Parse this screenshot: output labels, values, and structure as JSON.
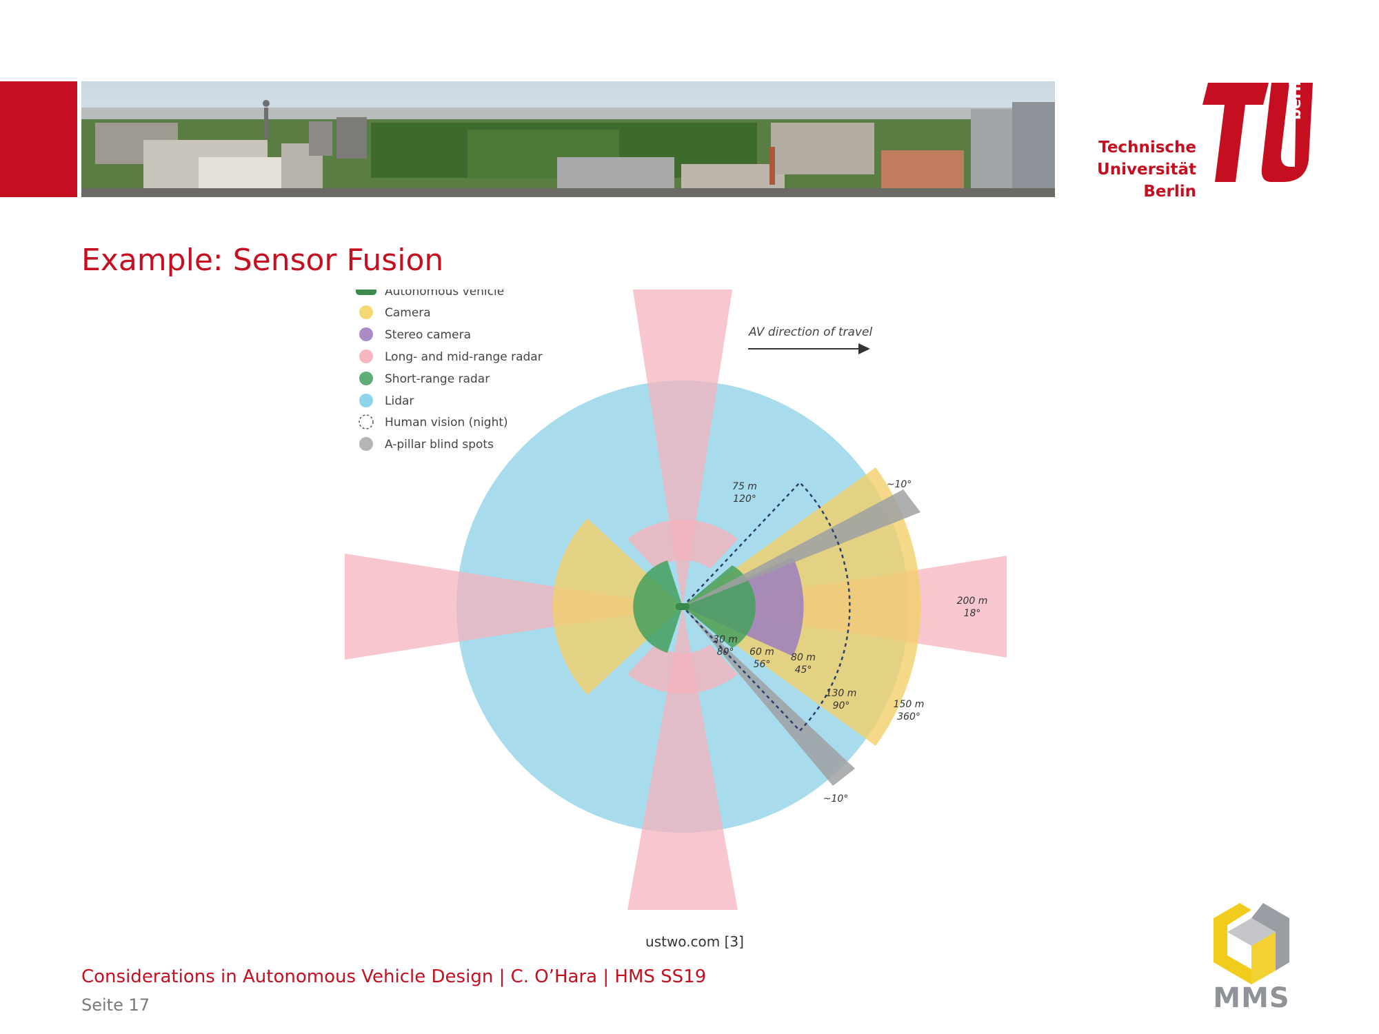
{
  "header": {
    "university_name_lines": [
      "Technische",
      "Universität",
      "Berlin"
    ],
    "logo_word": "berlin",
    "brand_color": "#c50e1f",
    "banner_image": "berlin-city-skyline-photo"
  },
  "slide": {
    "title": "Example: Sensor Fusion",
    "source": "ustwo.com [3]",
    "footer_title": "Considerations in Autonomous Vehicle Design | C. O’Hara | HMS SS19",
    "page_label": "Seite 17"
  },
  "diagram": {
    "legend": [
      {
        "label": "Autonomous vehicle",
        "color": "#3a8a4a",
        "icon": "car-icon"
      },
      {
        "label": "Camera",
        "color": "#f3d873",
        "icon": "dot"
      },
      {
        "label": "Stereo camera",
        "color": "#a98cc5",
        "icon": "dot"
      },
      {
        "label": "Long- and mid-range radar",
        "color": "#f5b8c0",
        "icon": "dot"
      },
      {
        "label": "Short-range radar",
        "color": "#5fae78",
        "icon": "dot"
      },
      {
        "label": "Lidar",
        "color": "#8dd4ea",
        "icon": "dot"
      },
      {
        "label": "Human vision (night)",
        "color": "#555555",
        "icon": "dashed-circle"
      },
      {
        "label": "A-pillar blind spots",
        "color": "#b5b5b5",
        "icon": "dot"
      }
    ],
    "direction_label": "AV direction of travel",
    "annotations": [
      {
        "lines": [
          "75 m",
          "120°"
        ]
      },
      {
        "lines": [
          "~10°"
        ]
      },
      {
        "lines": [
          "200 m",
          "18°"
        ]
      },
      {
        "lines": [
          "30 m",
          "80°"
        ]
      },
      {
        "lines": [
          "60 m",
          "56°"
        ]
      },
      {
        "lines": [
          "80 m",
          "45°"
        ]
      },
      {
        "lines": [
          "130 m",
          "90°"
        ]
      },
      {
        "lines": [
          "150 m",
          "360°"
        ]
      },
      {
        "lines": [
          "~10°"
        ]
      }
    ]
  },
  "mms_logo": {
    "text": "MMS",
    "colors": {
      "yellow": "#f2cc1c",
      "gray": "#9a9da3"
    }
  }
}
